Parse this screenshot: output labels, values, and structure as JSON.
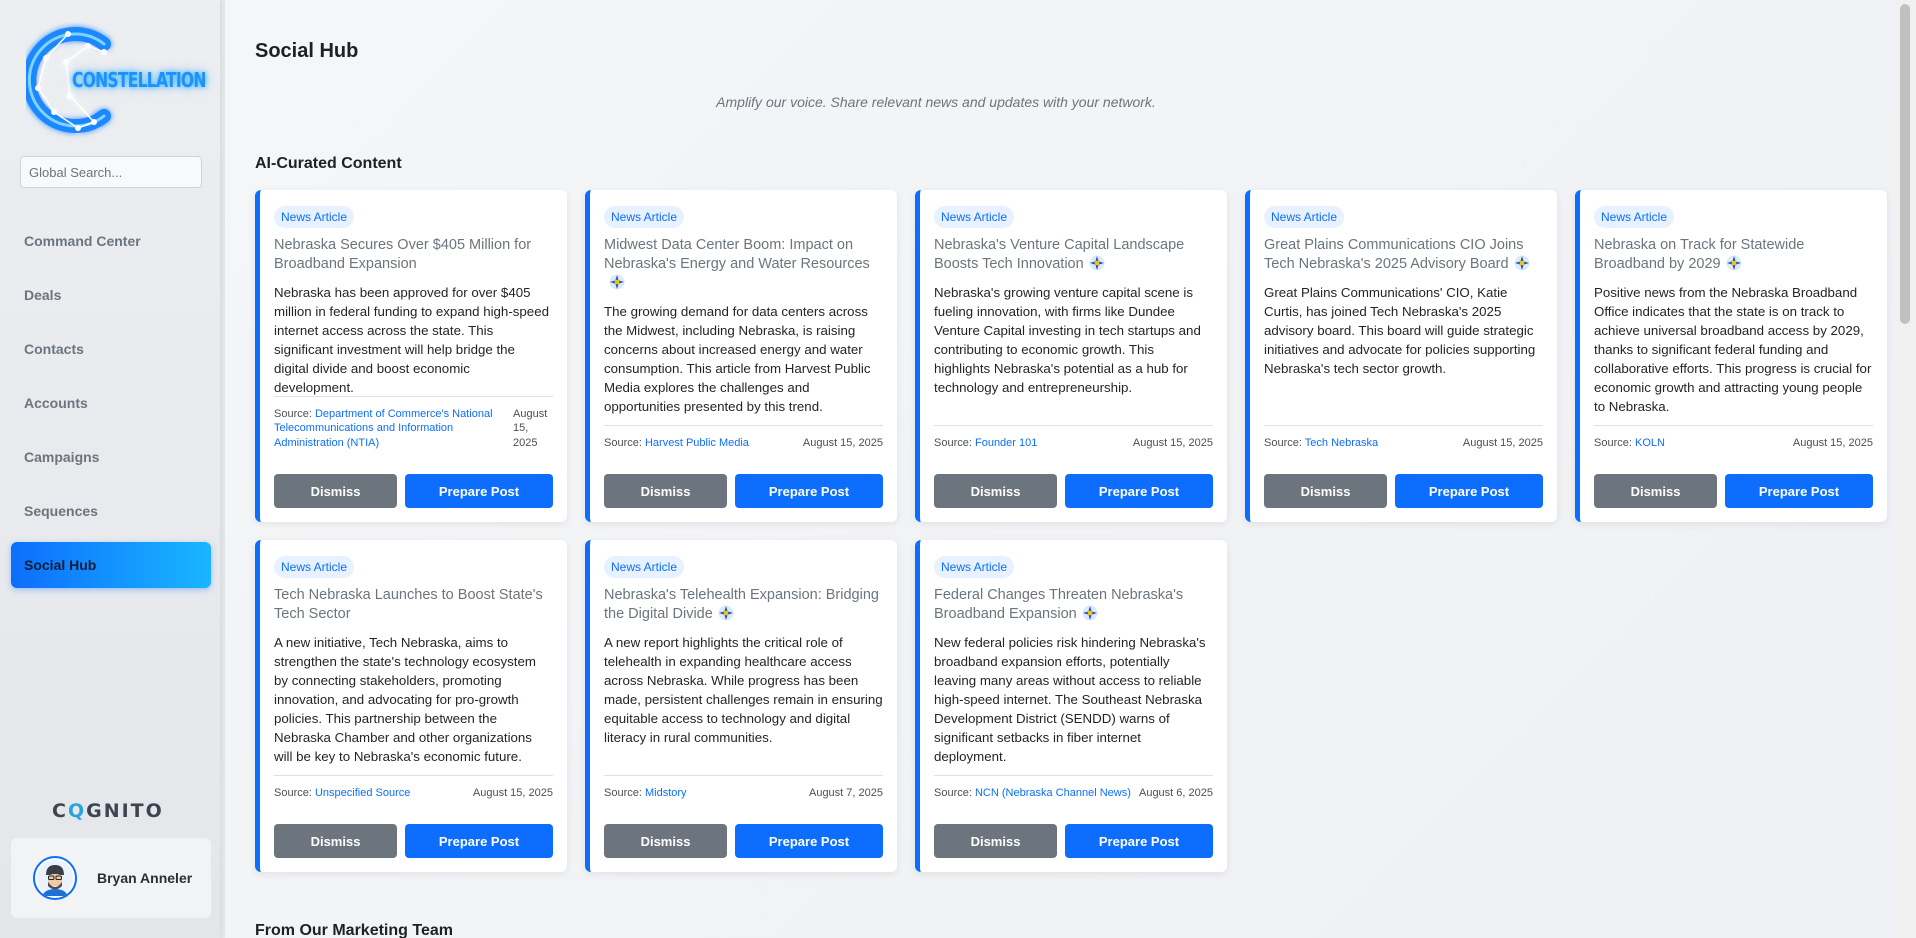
{
  "sidebar": {
    "logo_text": "CONSTELLATION",
    "search_placeholder": "Global Search...",
    "nav": [
      {
        "label": "Command Center",
        "icon": "dashboard-icon"
      },
      {
        "label": "Deals",
        "icon": "deals-icon"
      },
      {
        "label": "Contacts",
        "icon": "contacts-icon"
      },
      {
        "label": "Accounts",
        "icon": "accounts-icon"
      },
      {
        "label": "Campaigns",
        "icon": "campaigns-icon"
      },
      {
        "label": "Sequences",
        "icon": "sequences-icon"
      },
      {
        "label": "Social Hub",
        "icon": "social-icon",
        "active": true
      }
    ],
    "brand_footer": {
      "before": "C",
      "q": "Q",
      "after": "GNITO"
    },
    "user": {
      "name": "Bryan Anneler"
    }
  },
  "main": {
    "title": "Social Hub",
    "tagline": "Amplify our voice. Share relevant news and updates with your network.",
    "section_curated": "AI-Curated Content",
    "section_marketing": "From Our Marketing Team",
    "source_prefix": "Source:",
    "dismiss_label": "Dismiss",
    "prepare_label": "Prepare Post",
    "cards": [
      {
        "badge": "News Article",
        "title": "Nebraska Secures Over $405 Million for Broadband Expansion",
        "ai_icon": false,
        "body": "Nebraska has been approved for over $405 million in federal funding to expand high-speed internet access across the state. This significant investment will help bridge the digital divide and boost economic development.",
        "source": "Department of Commerce's National Telecommunications and Information Administration (NTIA)",
        "date": "August 15, 2025"
      },
      {
        "badge": "News Article",
        "title": "Midwest Data Center Boom: Impact on Nebraska's Energy and Water Resources",
        "ai_icon": true,
        "body": "The growing demand for data centers across the Midwest, including Nebraska, is raising concerns about increased energy and water consumption. This article from Harvest Public Media explores the challenges and opportunities presented by this trend.",
        "source": "Harvest Public Media",
        "date": "August 15, 2025"
      },
      {
        "badge": "News Article",
        "title": "Nebraska's Venture Capital Landscape Boosts Tech Innovation",
        "ai_icon": true,
        "body": "Nebraska's growing venture capital scene is fueling innovation, with firms like Dundee Venture Capital investing in tech startups and contributing to economic growth. This highlights Nebraska's potential as a hub for technology and entrepreneurship.",
        "source": "Founder 101",
        "date": "August 15, 2025"
      },
      {
        "badge": "News Article",
        "title": "Great Plains Communications CIO Joins Tech Nebraska's 2025 Advisory Board",
        "ai_icon": true,
        "body": "Great Plains Communications' CIO, Katie Curtis, has joined Tech Nebraska's 2025 advisory board. This board will guide strategic initiatives and advocate for policies supporting Nebraska's tech sector growth.",
        "source": "Tech Nebraska",
        "date": "August 15, 2025"
      },
      {
        "badge": "News Article",
        "title": "Nebraska on Track for Statewide Broadband by 2029",
        "ai_icon": true,
        "body": "Positive news from the Nebraska Broadband Office indicates that the state is on track to achieve universal broadband access by 2029, thanks to significant federal funding and collaborative efforts. This progress is crucial for economic growth and attracting young people to Nebraska.",
        "source": "KOLN",
        "date": "August 15, 2025"
      },
      {
        "badge": "News Article",
        "title": "Tech Nebraska Launches to Boost State's Tech Sector",
        "ai_icon": false,
        "body": "A new initiative, Tech Nebraska, aims to strengthen the state's technology ecosystem by connecting stakeholders, promoting innovation, and advocating for pro-growth policies. This partnership between the Nebraska Chamber and other organizations will be key to Nebraska's economic future.",
        "source": "Unspecified Source",
        "date": "August 15, 2025"
      },
      {
        "badge": "News Article",
        "title": "Nebraska's Telehealth Expansion: Bridging the Digital Divide",
        "ai_icon": true,
        "body": "A new report highlights the critical role of telehealth in expanding healthcare access across Nebraska. While progress has been made, persistent challenges remain in ensuring equitable access to technology and digital literacy in rural communities.",
        "source": "Midstory",
        "date": "August 7, 2025"
      },
      {
        "badge": "News Article",
        "title": "Federal Changes Threaten Nebraska's Broadband Expansion",
        "ai_icon": true,
        "body": "New federal policies risk hindering Nebraska's broadband expansion efforts, potentially leaving many areas without access to reliable high-speed internet. The Southeast Nebraska Development District (SENDD) warns of significant setbacks in fiber internet deployment.",
        "source": "NCN (Nebraska Channel News)",
        "date": "August 6, 2025"
      }
    ]
  }
}
